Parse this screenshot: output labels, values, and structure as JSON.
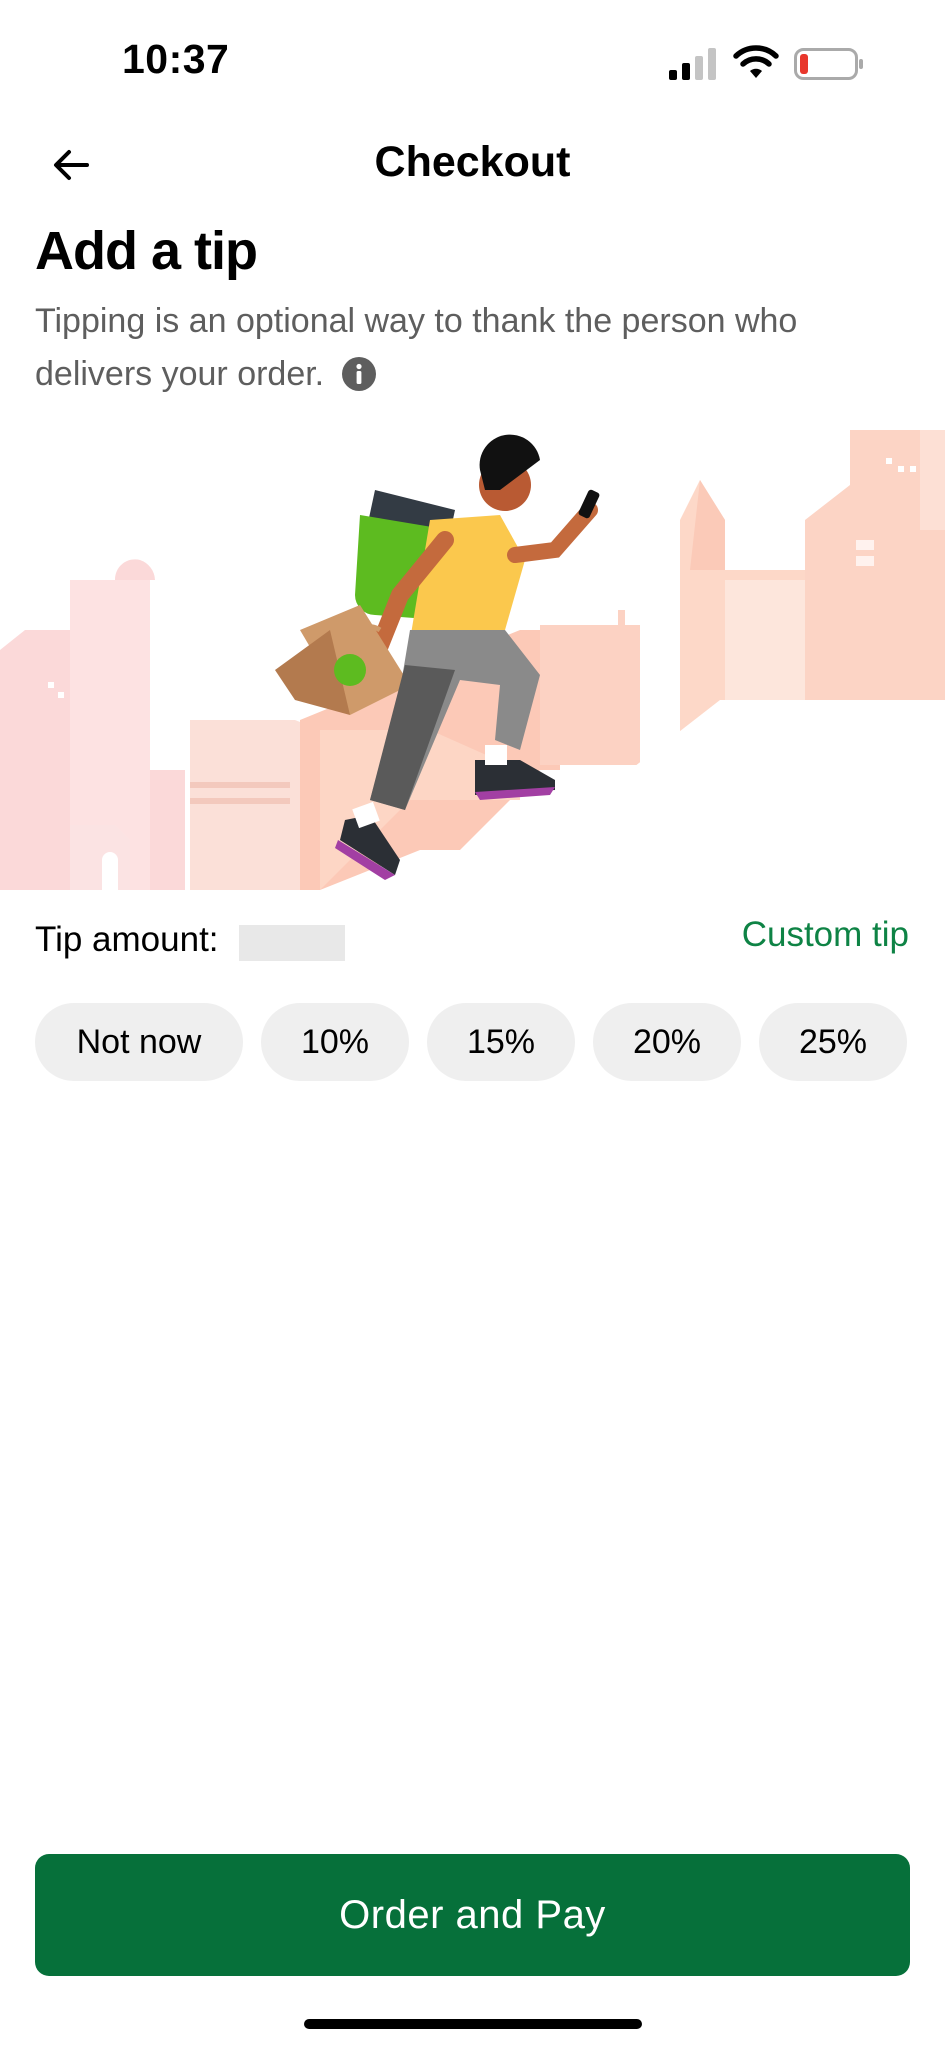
{
  "status_bar": {
    "time": "10:37",
    "battery_color": "#e8372c"
  },
  "header": {
    "title": "Checkout",
    "back_icon": "arrow-left-icon"
  },
  "tip_section": {
    "heading": "Add a tip",
    "description": "Tipping is an optional way to thank the person who delivers your order.",
    "info_icon": "info-icon",
    "illustration": "courier-running-illustration",
    "tip_amount_label": "Tip amount:",
    "custom_tip_label": "Custom tip",
    "options": [
      "Not now",
      "10%",
      "15%",
      "20%",
      "25%"
    ]
  },
  "footer": {
    "primary_button_label": "Order and Pay"
  },
  "colors": {
    "brand_green": "#06703a",
    "link_green": "#0e8345",
    "pill_bg": "#efefef"
  }
}
